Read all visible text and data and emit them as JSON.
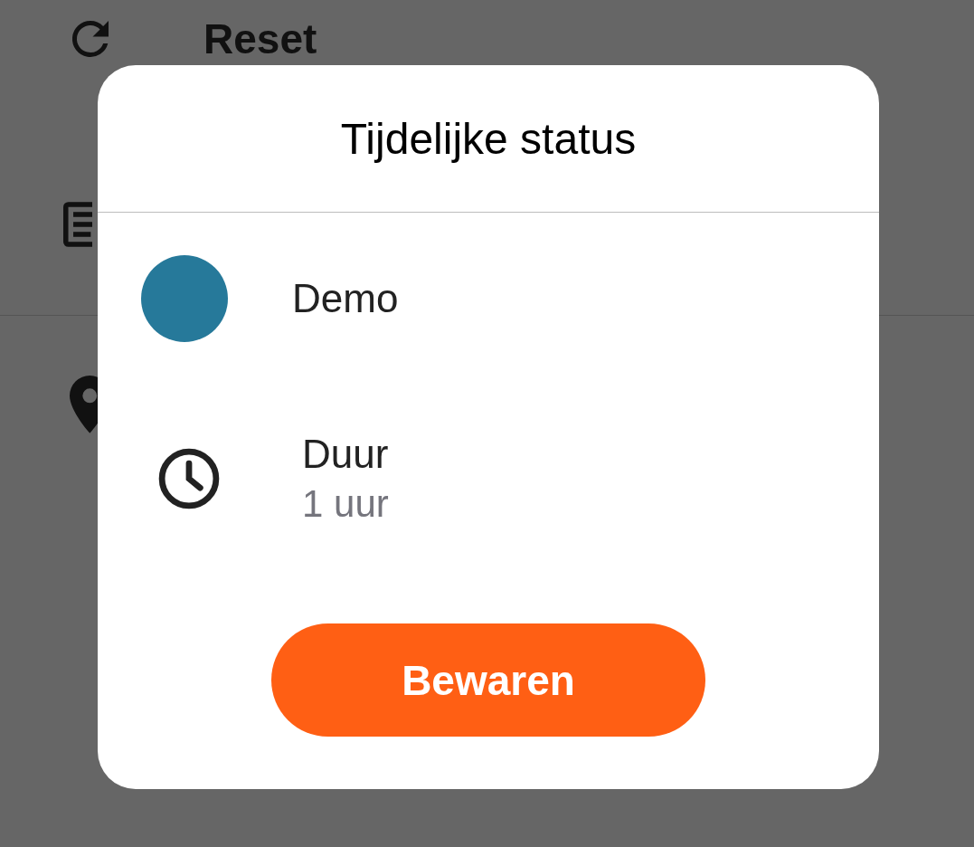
{
  "background_items": [
    {
      "kind": "reset",
      "label": "Reset"
    },
    {
      "kind": "notes"
    },
    {
      "kind": "location"
    }
  ],
  "dialog": {
    "title": "Tijdelijke status",
    "status": {
      "name": "Demo",
      "color": "#26799a"
    },
    "duration": {
      "label": "Duur",
      "value": "1 uur"
    },
    "button": "Bewaren"
  }
}
